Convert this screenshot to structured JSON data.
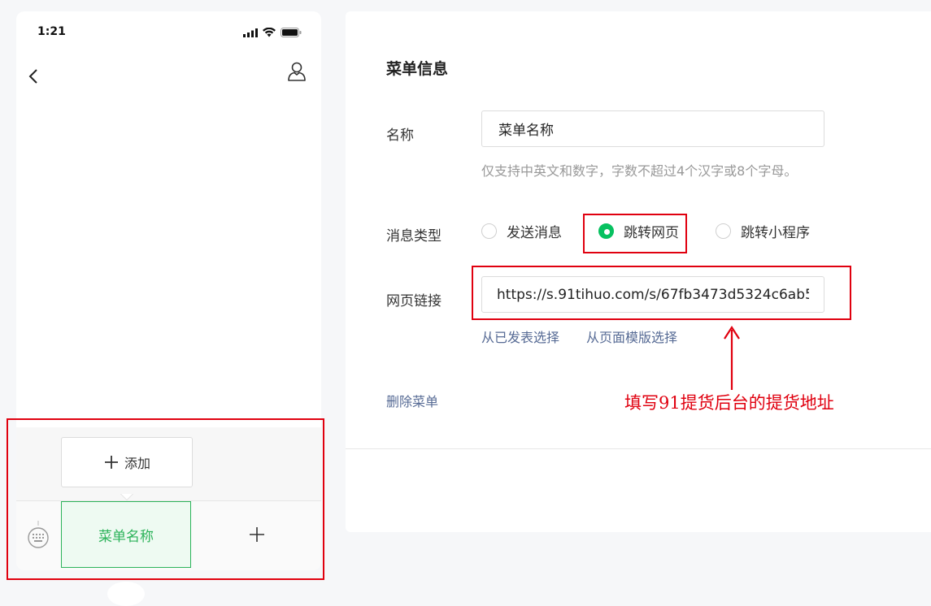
{
  "phone": {
    "time": "1:21",
    "menu_item_label": "菜单名称",
    "submenu_add_label": "添加",
    "icons": [
      "signal-icon",
      "wifi-icon",
      "battery-icon",
      "back-icon",
      "user-icon",
      "keyboard-icon",
      "plus-icon"
    ]
  },
  "panel": {
    "title": "菜单信息",
    "name_label": "名称",
    "name_value": "菜单名称",
    "name_hint": "仅支持中英文和数字，字数不超过4个汉字或8个字母。",
    "type_label": "消息类型",
    "type_options": [
      "发送消息",
      "跳转网页",
      "跳转小程序"
    ],
    "type_selected": "跳转网页",
    "url_label": "网页链接",
    "url_value": "https://s.91tihuo.com/s/67fb3473d5324c6ab5",
    "link_published": "从已发表选择",
    "link_template": "从页面模版选择",
    "delete_label": "删除菜单"
  },
  "annotation": {
    "text": "填写91提货后台的提货地址"
  },
  "colors": {
    "accent_green": "#07c160",
    "highlight_red": "#e0000f",
    "link_blue": "#576b95"
  }
}
